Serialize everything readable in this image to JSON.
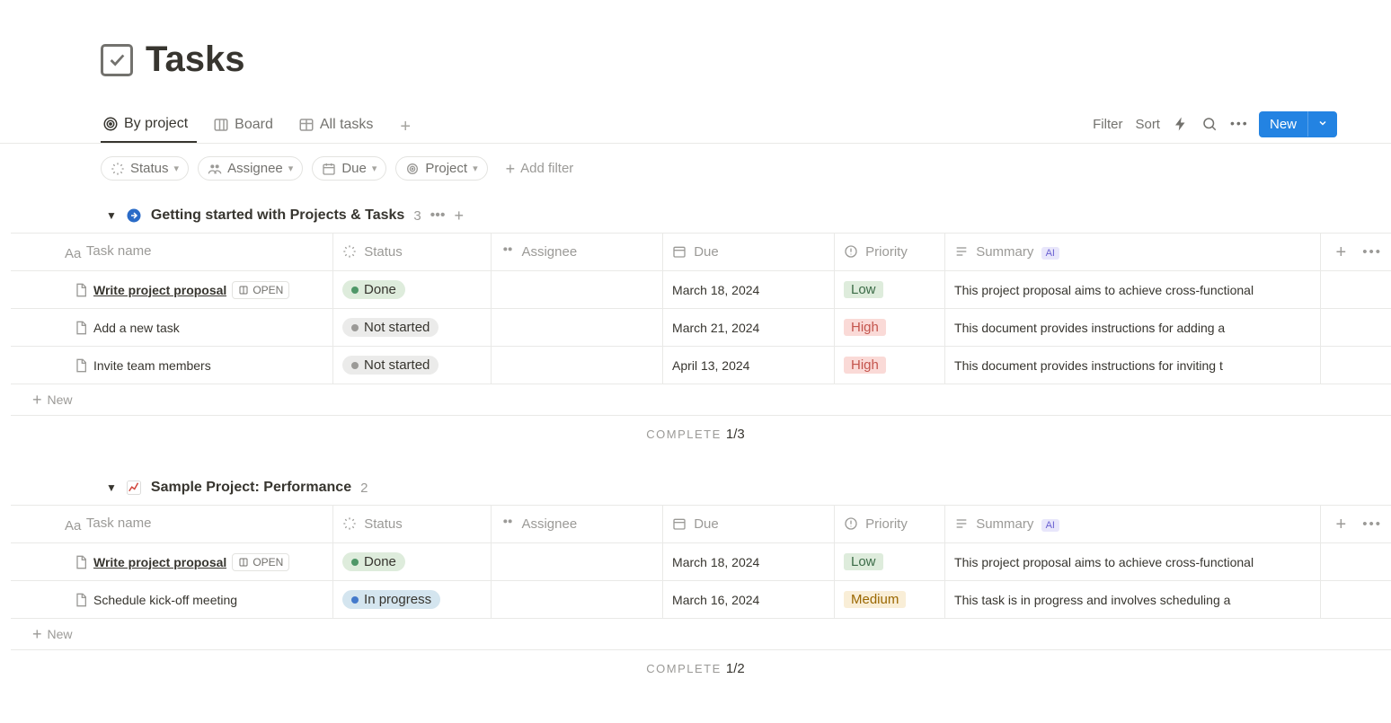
{
  "header": {
    "title": "Tasks"
  },
  "tabs": {
    "items": [
      {
        "label": "By project",
        "active": true
      },
      {
        "label": "Board",
        "active": false
      },
      {
        "label": "All tasks",
        "active": false
      }
    ]
  },
  "toolbar": {
    "filter": "Filter",
    "sort": "Sort",
    "new": "New"
  },
  "filter_chips": {
    "status": "Status",
    "assignee": "Assignee",
    "due": "Due",
    "project": "Project",
    "add": "Add filter"
  },
  "columns": {
    "name": "Task name",
    "status": "Status",
    "assignee": "Assignee",
    "due": "Due",
    "priority": "Priority",
    "summary": "Summary",
    "ai": "AI"
  },
  "open_label": "OPEN",
  "new_row": "New",
  "complete_label": "COMPLETE",
  "groups": [
    {
      "icon": "arrow-circle",
      "name": "Getting started with Projects & Tasks",
      "count": "3",
      "complete": "1/3",
      "rows": [
        {
          "title": "Write project proposal",
          "hover": true,
          "status": "Done",
          "status_class": "s-done",
          "due": "March 18, 2024",
          "priority": "Low",
          "prio_class": "p-low",
          "summary": "This project proposal aims to achieve cross-functional"
        },
        {
          "title": "Add a new task",
          "hover": false,
          "status": "Not started",
          "status_class": "s-not",
          "due": "March 21, 2024",
          "priority": "High",
          "prio_class": "p-high",
          "summary": "This document provides instructions for adding a"
        },
        {
          "title": "Invite team members",
          "hover": false,
          "status": "Not started",
          "status_class": "s-not",
          "due": "April 13, 2024",
          "priority": "High",
          "prio_class": "p-high",
          "summary": "This document provides instructions for inviting t"
        }
      ]
    },
    {
      "icon": "chart",
      "name": "Sample Project: Performance",
      "count": "2",
      "complete": "1/2",
      "rows": [
        {
          "title": "Write project proposal",
          "hover": true,
          "status": "Done",
          "status_class": "s-done",
          "due": "March 18, 2024",
          "priority": "Low",
          "prio_class": "p-low",
          "summary": "This project proposal aims to achieve cross-functional"
        },
        {
          "title": "Schedule kick-off meeting",
          "hover": false,
          "status": "In progress",
          "status_class": "s-prog",
          "due": "March 16, 2024",
          "priority": "Medium",
          "prio_class": "p-med",
          "summary": "This task is in progress and involves scheduling a"
        }
      ]
    }
  ]
}
